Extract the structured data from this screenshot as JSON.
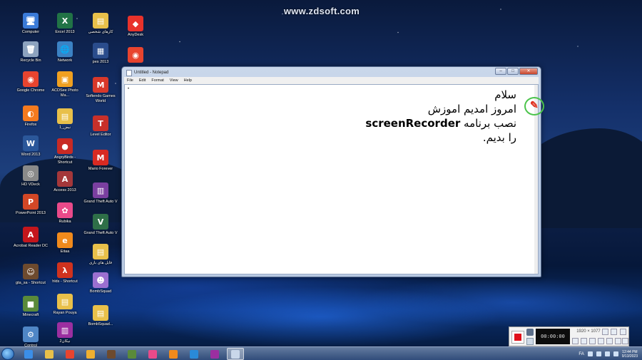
{
  "watermark": "www.zdsoft.com",
  "desktop_icons": [
    {
      "label": "Computer",
      "color": "#3a7ad8",
      "glyph": "🖥"
    },
    {
      "label": "Recycle Bin",
      "color": "#8da3bf",
      "glyph": "🗑"
    },
    {
      "label": "Google Chrome",
      "color": "#e8442f",
      "glyph": "◉"
    },
    {
      "label": "Firefox",
      "color": "#f57a1f",
      "glyph": "◐"
    },
    {
      "label": "Word 2013",
      "color": "#2b579a",
      "glyph": "W"
    },
    {
      "label": "HD VDeck",
      "color": "#8a8a8a",
      "glyph": "◎"
    },
    {
      "label": "PowerPoint 2013",
      "color": "#d24726",
      "glyph": "P"
    },
    {
      "label": "Acrobat Reader DC",
      "color": "#c4161c",
      "glyph": "A"
    },
    {
      "label": "gta_sa - Shortcut",
      "color": "#6d4a2e",
      "glyph": "☺"
    },
    {
      "label": "Minecraft",
      "color": "#5a8a3a",
      "glyph": "■"
    },
    {
      "label": "Control",
      "color": "#4f86c6",
      "glyph": "⚙"
    },
    {
      "label": "Excel 2013",
      "color": "#217346",
      "glyph": "X"
    },
    {
      "label": "Network",
      "color": "#3b82c4",
      "glyph": "🌐"
    },
    {
      "label": "ACDSee Photo Ma...",
      "color": "#f0a020",
      "glyph": "▣"
    },
    {
      "label": "نبض_1",
      "color": "#e8c04a",
      "glyph": "▤"
    },
    {
      "label": "AngryBirds - Shortcut",
      "color": "#c82a24",
      "glyph": "●"
    },
    {
      "label": "Access 2013",
      "color": "#a4373a",
      "glyph": "A"
    },
    {
      "label": "Rubika",
      "color": "#e94a8a",
      "glyph": "✿"
    },
    {
      "label": "Eitaa",
      "color": "#f08a1c",
      "glyph": "e"
    },
    {
      "label": "hlds - Shortcut",
      "color": "#d0321e",
      "glyph": "λ"
    },
    {
      "label": "Rayan Pouya",
      "color": "#e8c04a",
      "glyph": "▤"
    },
    {
      "label": "نیکان2",
      "color": "#9b2fa0",
      "glyph": "▥"
    },
    {
      "label": "کارهای شخصی",
      "color": "#e8c04a",
      "glyph": "▤"
    },
    {
      "label": "pes 2013",
      "color": "#2a4c8c",
      "glyph": "▦"
    },
    {
      "label": "Softendo Games World",
      "color": "#d8382a",
      "glyph": "M"
    },
    {
      "label": "Level Editor",
      "color": "#c8302a",
      "glyph": "T"
    },
    {
      "label": "Mario Forever",
      "color": "#d82a22",
      "glyph": "M"
    },
    {
      "label": "Grand Theft Auto V",
      "color": "#7a3fa0",
      "glyph": "▥"
    },
    {
      "label": "Grand Theft Auto V",
      "color": "#2e6f48",
      "glyph": "V"
    },
    {
      "label": "فایل های بازی",
      "color": "#e8c04a",
      "glyph": "▤"
    },
    {
      "label": "BombSquad",
      "color": "#9b6fd0",
      "glyph": "☻"
    },
    {
      "label": "BombSquad...",
      "color": "#e8c04a",
      "glyph": "▤"
    },
    {
      "label": "AnyDesk",
      "color": "#e8322b",
      "glyph": "◆"
    },
    {
      "label": "",
      "color": "#e8442f",
      "glyph": "◉"
    }
  ],
  "notepad": {
    "title": "Untitled - Notepad",
    "menu": [
      "File",
      "Edit",
      "Format",
      "View",
      "Help"
    ],
    "window_buttons": {
      "minimize": "–",
      "maximize": "□",
      "close": "✕"
    },
    "lines": [
      {
        "text": "سلام",
        "ltr_part": ""
      },
      {
        "text": "امروز امدیم اموزش",
        "ltr_part": ""
      },
      {
        "text": "نصب برنامه",
        "ltr_part": "screenRecorder"
      },
      {
        "text": "را بدیم.",
        "ltr_part": ""
      }
    ]
  },
  "recorder": {
    "time": "00:00:00",
    "resolution": "1920 × 1077"
  },
  "taskbar": {
    "items": [
      {
        "name": "ie",
        "color": "#3b8ee8"
      },
      {
        "name": "explorer",
        "color": "#e8c04a"
      },
      {
        "name": "chrome",
        "color": "#e8442f"
      },
      {
        "name": "media",
        "color": "#f0b030"
      },
      {
        "name": "game",
        "color": "#6d4a2e"
      },
      {
        "name": "minecraft",
        "color": "#5a8a3a"
      },
      {
        "name": "rubika",
        "color": "#e94a8a"
      },
      {
        "name": "eitaa",
        "color": "#f08a1c"
      },
      {
        "name": "edge",
        "color": "#2a8ad8"
      },
      {
        "name": "winrar",
        "color": "#9b2fa0"
      },
      {
        "name": "notepad",
        "color": "#c9d7ea"
      }
    ],
    "language": "FA",
    "clock_time": "12:44 PM",
    "clock_date": "9/13/2023"
  }
}
